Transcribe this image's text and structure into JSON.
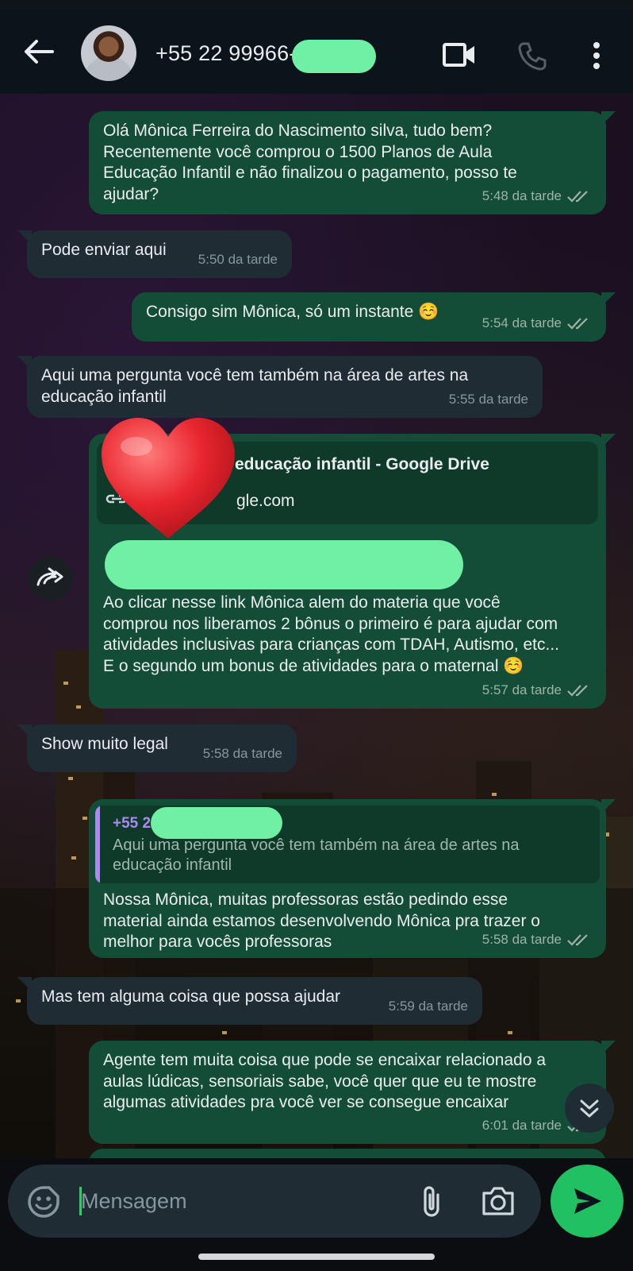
{
  "header": {
    "contact": "+55 22 99966-"
  },
  "messages": [
    {
      "id": "m1",
      "dir": "out",
      "text": "Olá Mônica Ferreira do Nascimento silva, tudo bem?\nRecentemente você comprou o 1500 Planos de Aula\nEducação Infantil e não finalizou o pagamento, posso te\najudar?",
      "time": "5:48 da tarde"
    },
    {
      "id": "m2",
      "dir": "in",
      "text": "Pode enviar aqui",
      "time": "5:50 da tarde"
    },
    {
      "id": "m3",
      "dir": "out",
      "text": "Consigo sim Mônica, só um instante ☺️",
      "time": "5:54 da tarde"
    },
    {
      "id": "m4",
      "dir": "in",
      "text": "Aqui uma pergunta você tem também na área de artes na\neducação infantil",
      "time": "5:55 da tarde"
    },
    {
      "id": "m5",
      "dir": "out",
      "preview_title": "educação infantil - Google Drive",
      "preview_domain": "gle.com",
      "text": "Ao clicar nesse link Mônica alem do materia que você\ncomprou nos liberamos 2 bônus o primeiro é para ajudar com\natividades inclusivas para crianças com TDAH, Autismo, etc...\nE o segundo um bonus de atividades para o maternal ☺️",
      "time": "5:57 da tarde"
    },
    {
      "id": "m6",
      "dir": "in",
      "text": "Show muito legal",
      "time": "5:58 da tarde"
    },
    {
      "id": "m7",
      "dir": "out",
      "quote_author": "+55 22",
      "quote_text": "Aqui uma pergunta você tem também na área de artes na\neducação infantil",
      "text": "Nossa Mônica, muitas professoras estão pedindo esse\nmaterial ainda estamos desenvolvendo Mônica pra trazer o\nmelhor para vocês professoras",
      "time": "5:58 da tarde"
    },
    {
      "id": "m8",
      "dir": "in",
      "text": "Mas tem alguma coisa que possa ajudar",
      "time": "5:59 da tarde"
    },
    {
      "id": "m9",
      "dir": "out",
      "text": "Agente tem muita coisa que pode se encaixar relacionado a\naulas lúdicas, sensoriais sabe, você quer que eu te mostre\nalgumas atividades pra você ver se consegue encaixar",
      "time": "6:01 da tarde"
    }
  ],
  "composer": {
    "placeholder": "Mensagem"
  },
  "colors": {
    "header_bg": "#0b141a",
    "outgoing_bubble": "#144d37",
    "incoming_bubble": "#1f2c34",
    "accent": "#21c063",
    "redaction": "#6ff0a5"
  },
  "icons": [
    "back-arrow-icon",
    "video-call-icon",
    "voice-call-icon",
    "more-menu-icon",
    "forward-icon",
    "scroll-down-icon",
    "sticker-icon",
    "attach-icon",
    "camera-icon",
    "send-icon",
    "double-check-icon",
    "heart-emoji-icon",
    "link-icon"
  ]
}
